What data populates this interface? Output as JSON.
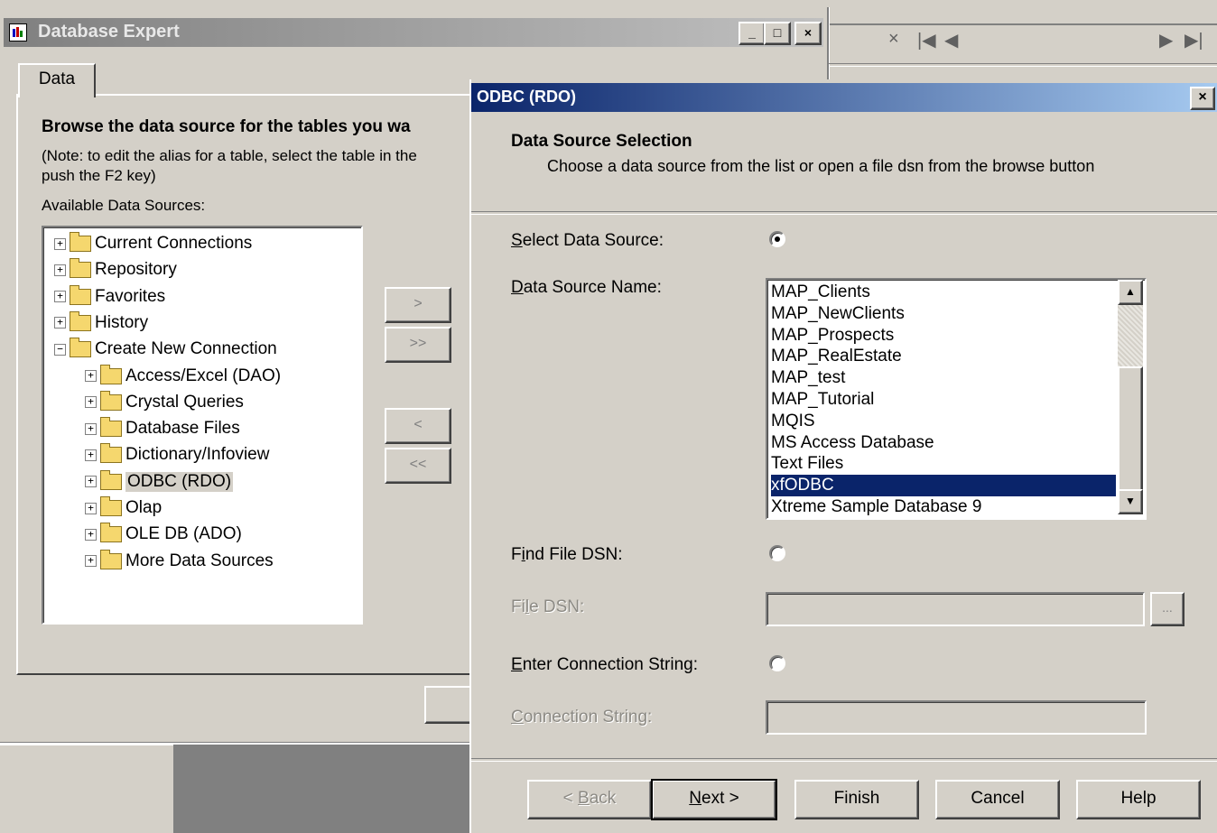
{
  "background_window": {
    "title": "Database Expert",
    "controls": [
      "_",
      "□",
      "×"
    ],
    "tab": "Data",
    "browse_heading": "Browse the data source for the tables you wa",
    "note_line1": "(Note: to edit the alias for a table, select the table in the",
    "note_line2": "push the F2 key)",
    "available_label": "Available Data Sources:",
    "tree": [
      {
        "label": "Current Connections",
        "level": 0,
        "expander": "+"
      },
      {
        "label": "Repository",
        "level": 0,
        "expander": "+"
      },
      {
        "label": "Favorites",
        "level": 0,
        "expander": "+"
      },
      {
        "label": "History",
        "level": 0,
        "expander": "+"
      },
      {
        "label": "Create New Connection",
        "level": 0,
        "expander": "−"
      },
      {
        "label": "Access/Excel (DAO)",
        "level": 1,
        "expander": "+"
      },
      {
        "label": "Crystal Queries",
        "level": 1,
        "expander": "+"
      },
      {
        "label": "Database Files",
        "level": 1,
        "expander": "+"
      },
      {
        "label": "Dictionary/Infoview",
        "level": 1,
        "expander": "+"
      },
      {
        "label": "ODBC (RDO)",
        "level": 1,
        "expander": "+"
      },
      {
        "label": "Olap",
        "level": 1,
        "expander": "+"
      },
      {
        "label": "OLE DB (ADO)",
        "level": 1,
        "expander": "+"
      },
      {
        "label": "More Data Sources",
        "level": 1,
        "expander": "+"
      }
    ],
    "arrow_buttons": [
      ">",
      ">>",
      "<",
      "<<"
    ]
  },
  "nav_icons": [
    "×",
    "|◀",
    "◀",
    "▶",
    "▶|"
  ],
  "dialog": {
    "title": "ODBC (RDO)",
    "close": "×",
    "heading": "Data Source Selection",
    "subheading": "Choose a data source from the list or open a file dsn from the browse button",
    "select_ds_label": "Select Data Source:",
    "dsn_name_label": "Data Source Name:",
    "dsn_list": [
      "MAP_Clients",
      "MAP_NewClients",
      "MAP_Prospects",
      "MAP_RealEstate",
      "MAP_test",
      "MAP_Tutorial",
      "MQIS",
      "MS Access Database",
      "Text Files",
      "xfODBC",
      "Xtreme Sample Database 9"
    ],
    "selected_dsn": "xfODBC",
    "find_file_label": "Find File DSN:",
    "file_dsn_label": "File DSN:",
    "browse_label": "...",
    "enter_conn_label": "Enter Connection String:",
    "conn_string_label": "Connection String:",
    "buttons": {
      "back": "< Back",
      "next": "Next >",
      "finish": "Finish",
      "cancel": "Cancel",
      "help": "Help"
    }
  }
}
